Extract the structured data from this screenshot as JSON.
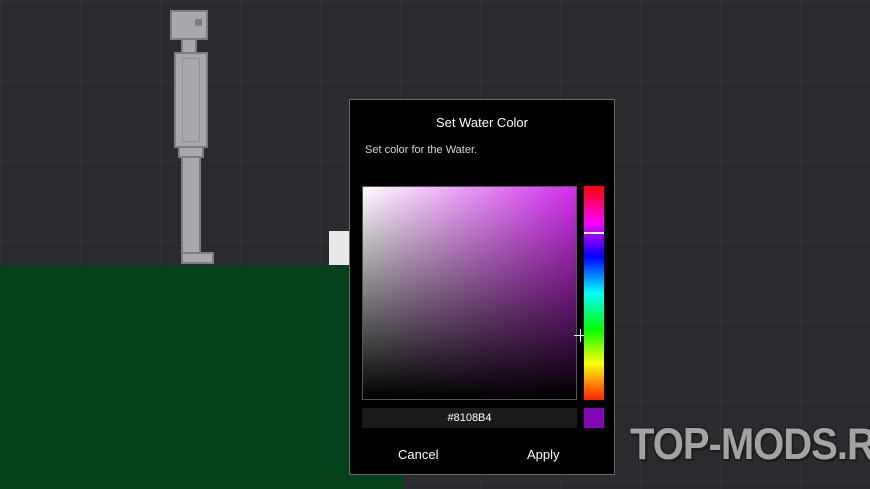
{
  "dialog": {
    "title": "Set Water Color",
    "description": "Set color for the Water.",
    "hex_value": "#8108B4",
    "swatch_color": "#8108B4",
    "cancel_label": "Cancel",
    "apply_label": "Apply"
  },
  "watermark": "TOP-MODS.RU",
  "colors": {
    "background": "#2a2b2e",
    "ground": "#04411b",
    "hue_base": "#d52cf0",
    "ragdoll": "#a9a9ad"
  }
}
